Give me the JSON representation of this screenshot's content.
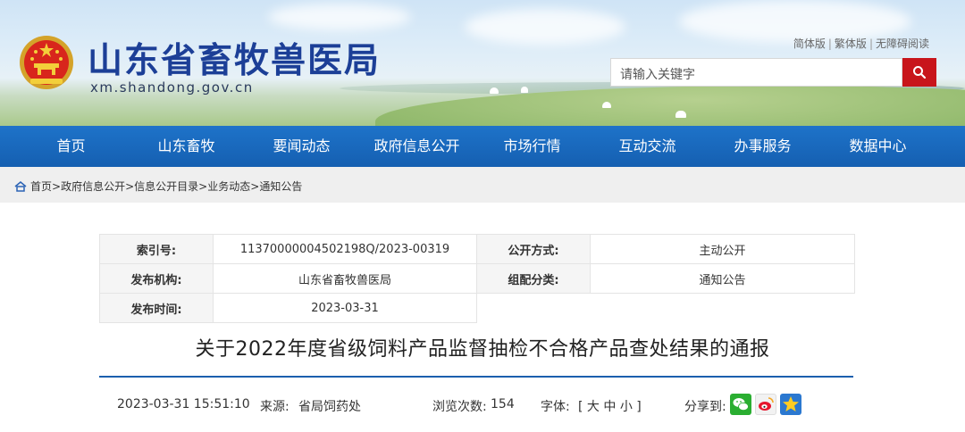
{
  "header": {
    "site_title": "山东省畜牧兽医局",
    "domain": "xm.shandong.gov.cn",
    "lang_links": [
      "简体版",
      "繁体版",
      "无障碍阅读"
    ],
    "search_placeholder": "请输入关键字"
  },
  "nav": {
    "items": [
      "首页",
      "山东畜牧",
      "要闻动态",
      "政府信息公开",
      "市场行情",
      "互动交流",
      "办事服务",
      "数据中心"
    ]
  },
  "breadcrumb": {
    "items": [
      "首页",
      "政府信息公开",
      "信息公开目录",
      "业务动态",
      "通知公告"
    ],
    "separator": ">"
  },
  "meta": {
    "index_label": "索引号:",
    "index_value": "11370000004502198Q/2023-00319",
    "method_label": "公开方式:",
    "method_value": "主动公开",
    "publisher_label": "发布机构:",
    "publisher_value": "山东省畜牧兽医局",
    "category_label": "组配分类:",
    "category_value": "通知公告",
    "date_label": "发布时间:",
    "date_value": "2023-03-31"
  },
  "article": {
    "title": "关于2022年度省级饲料产品监督抽检不合格产品查处结果的通报",
    "datetime": "2023-03-31 15:51:10",
    "source_label": "来源:",
    "source_value": "省局饲药处",
    "views_label": "浏览次数:",
    "views_value": "154",
    "font_label": "字体:",
    "font_sizes": [
      "大",
      "中",
      "小"
    ],
    "share_label": "分享到:"
  },
  "colors": {
    "brand_blue": "#1c3f97",
    "nav_blue": "#1a6bc0",
    "search_red": "#c8151b",
    "divider_blue": "#1b5fae"
  },
  "icons": [
    "home-icon",
    "search-icon",
    "wechat-icon",
    "weibo-icon",
    "qzone-icon",
    "national-emblem"
  ]
}
